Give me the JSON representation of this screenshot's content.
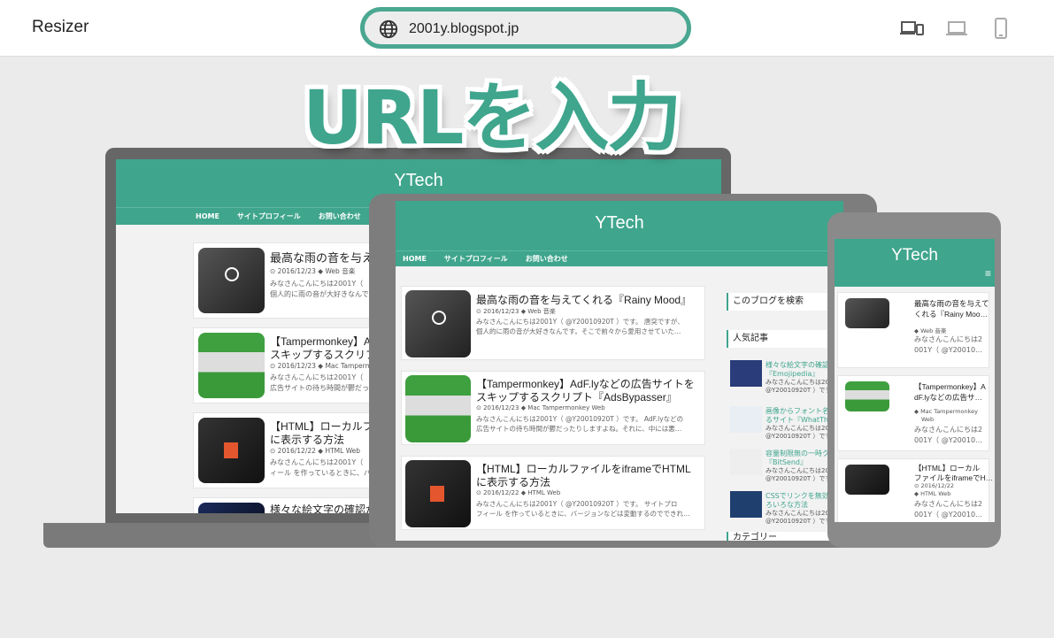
{
  "app": {
    "title": "Resizer"
  },
  "url": {
    "value": "2001y.blogspot.jp"
  },
  "caption": "URLを入力",
  "site": {
    "title": "YTech",
    "nav": [
      "HOME",
      "サイトプロフィール",
      "お問い合わせ"
    ],
    "menu_glyph": "≡"
  },
  "laptop_posts": [
    {
      "title": "最高な雨の音を与えて",
      "date": "2016/12/23",
      "tags": "Web 音楽",
      "excerpt1": "みなさんこんにちは2001Y（",
      "excerpt2": "個人的に雨の音が大好きなんで"
    },
    {
      "title": "【Tampermonkey】A",
      "title2": "スキップするスクリプ",
      "date": "2016/12/23",
      "tags": "Mac Tampermo",
      "excerpt1": "みなさんこんにちは2001Y（",
      "excerpt2": "広告サイトの待ち時間が鬱だっ"
    },
    {
      "title": "【HTML】ローカルフ",
      "title2": "に表示する方法",
      "date": "2016/12/22",
      "tags": "HTML Web",
      "excerpt1": "みなさんこんにちは2001Y（",
      "excerpt2": "ィール を作っているときに、バ"
    },
    {
      "title": "様々な絵文字の確認が"
    }
  ],
  "tablet_posts": [
    {
      "title": "最高な雨の音を与えてくれる『Rainy Mood』",
      "date": "2016/12/23",
      "tags": "Web 音楽",
      "excerpt1": "みなさんこんにちは2001Y（ @Y20010920T ）です。 唐突ですが、",
      "excerpt2": "個人的に雨の音が大好きなんです。そこで前々から愛用させていた…"
    },
    {
      "title": "【Tampermonkey】AdF.lyなどの広告サイトを",
      "title2": "スキップするスクリプト『AdsBypasser』",
      "date": "2016/12/23",
      "tags": "Mac Tampermonkey Web",
      "excerpt1": "みなさんこんにちは2001Y（ @Y20010920T ）です。 AdF.lyなどの",
      "excerpt2": "広告サイトの待ち時間が鬱だったりしますよね。それに、中には悪…"
    },
    {
      "title": "【HTML】ローカルファイルをiframeでHTML",
      "title2": "に表示する方法",
      "date": "2016/12/22",
      "tags": "HTML Web",
      "excerpt1": "みなさんこんにちは2001Y（ @Y20010920T ）です。 サイトプロ",
      "excerpt2": "フィール を作っているときに、バージョンなどは変動するのでできれ…"
    }
  ],
  "tablet_sidebar": {
    "search_heading": "このブログを検索",
    "popular_heading": "人気記事",
    "items": [
      {
        "title": "様々な絵文字の確認が",
        "title2": "『Emojipedia』",
        "sub": "みなさんこんにちは200",
        "sub2": "@Y20010920T ）です"
      },
      {
        "title": "画像からフォント名を",
        "title2": "るサイト『WhatThe",
        "sub": "みなさんこんにちは200",
        "sub2": "@Y20010920T ）です"
      },
      {
        "title": "容量制限無の一時ク",
        "title2": "『BitSend』",
        "sub": "みなさんこんにちは200",
        "sub2": "@Y20010920T ）です"
      },
      {
        "title": "CSSでリンクを無効",
        "title2": "ろいろな方法",
        "sub": "みなさんこんにちは200",
        "sub2": "@Y20010920T ）です"
      }
    ],
    "category_heading": "カテゴリー"
  },
  "phone_posts": [
    {
      "title": "最高な雨の音を与えて",
      "title2": "くれる『Rainy Moo…",
      "tags": "Web 音楽",
      "excerpt1": "みなさんこんにちは2",
      "excerpt2": "001Y（ @Y20010…"
    },
    {
      "title": "【Tampermonkey】A",
      "title2": "dF.lyなどの広告サ…",
      "tags": "Mac Tampermonkey",
      "tags2": "Web",
      "excerpt1": "みなさんこんにちは2",
      "excerpt2": "001Y（ @Y20010…"
    },
    {
      "title": "【HTML】ローカル",
      "title2": "ファイルをiframeでH…",
      "date": "2016/12/22",
      "tags": "HTML Web",
      "excerpt1": "みなさんこんにちは2",
      "excerpt2": "001Y（ @Y20010…"
    }
  ]
}
